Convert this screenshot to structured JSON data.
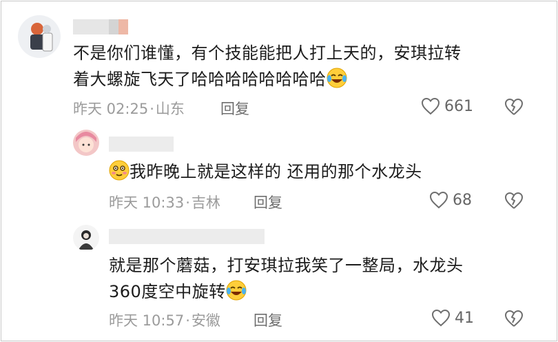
{
  "comments": [
    {
      "text_lines": [
        "不是你们谁懂，有个技能能把人打上天的，安琪拉转",
        "着大螺旋飞天了哈哈哈哈哈哈哈哈"
      ],
      "emoji": "laugh-cry-emoji",
      "time": "昨天 02:25",
      "location": "山东",
      "reply_label": "回复",
      "likes": "661",
      "dislike_icon": "broken-heart-icon"
    },
    {
      "emoji_lead": "blush-emoji",
      "text_lines": [
        "我昨晚上就是这样的 还用的那个水龙头"
      ],
      "time": "昨天 10:33",
      "location": "吉林",
      "reply_label": "回复",
      "likes": "68",
      "dislike_icon": "broken-heart-icon"
    },
    {
      "text_lines": [
        "就是那个蘑菇，打安琪拉我笑了一整局，水龙头",
        "360度空中旋转"
      ],
      "emoji": "laugh-cry-emoji",
      "time": "昨天 10:57",
      "location": "安徽",
      "reply_label": "回复",
      "likes": "41",
      "dislike_icon": "broken-heart-icon"
    }
  ],
  "separator": "·",
  "colors": {
    "text": "#1c1c1c",
    "meta": "#9b9b9b",
    "icon": "#6e6e6e"
  }
}
